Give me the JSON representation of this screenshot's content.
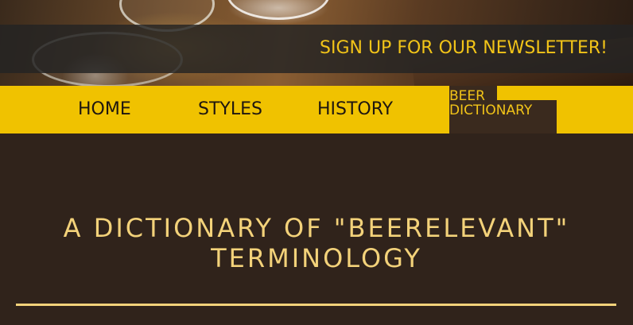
{
  "header": {
    "newsletter_label": "SIGN UP FOR OUR NEWSLETTER!"
  },
  "nav": {
    "items": [
      {
        "label": "HOME"
      },
      {
        "label": "STYLES"
      },
      {
        "label": "HISTORY"
      },
      {
        "label_line1": "BEER",
        "label_line2": "DICTIONARY",
        "active": true
      }
    ]
  },
  "main": {
    "title_line1": "A DICTIONARY OF \"BEERELEVANT\"",
    "title_line2": "TERMINOLOGY"
  },
  "colors": {
    "accent_yellow": "#f0c200",
    "background": "#30231b",
    "title": "#f3d27a"
  }
}
